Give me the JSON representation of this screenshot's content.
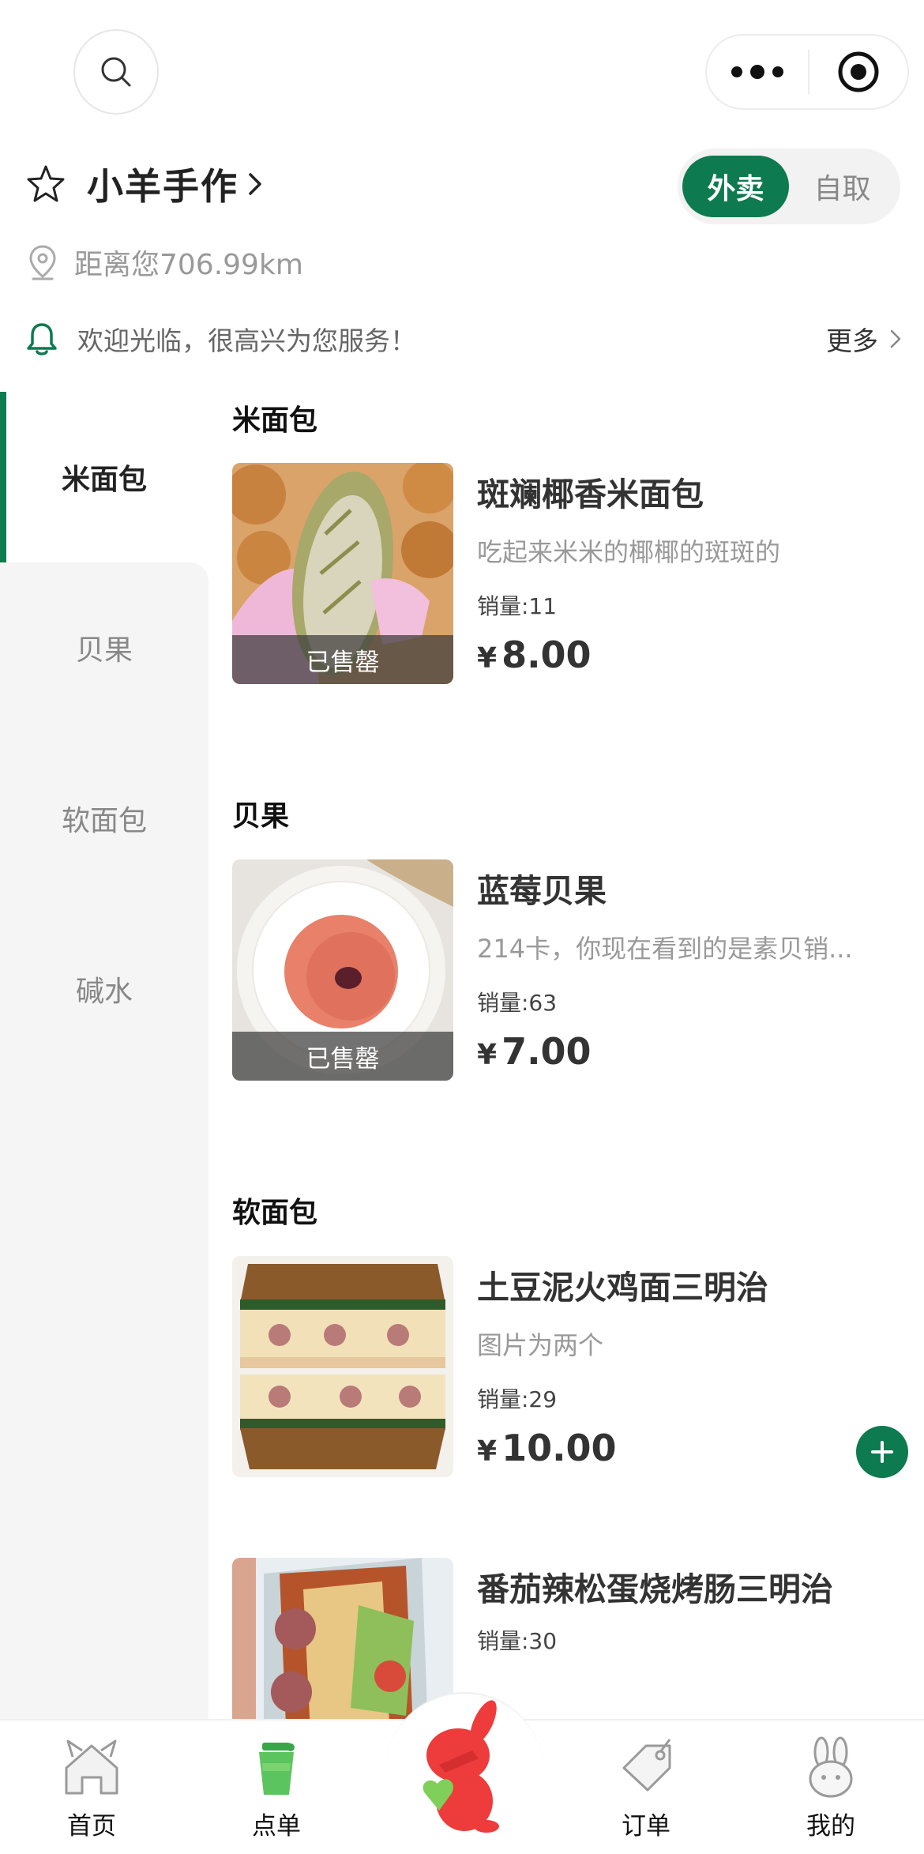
{
  "top": {
    "search_icon": "search-icon",
    "more_icon": "more-dots-icon",
    "target_icon": "target-icon"
  },
  "shop": {
    "name": "小羊手作",
    "distance": "距离您706.99km",
    "notice": "欢迎光临，很高兴为您服务！",
    "more_label": "更多",
    "delivery_label": "外卖",
    "pickup_label": "自取"
  },
  "sidebar": {
    "items": [
      {
        "label": "米面包",
        "active": true
      },
      {
        "label": "贝果",
        "active": false
      },
      {
        "label": "软面包",
        "active": false
      },
      {
        "label": "碱水",
        "active": false
      }
    ]
  },
  "sections": [
    {
      "title": "米面包",
      "products": [
        {
          "name": "斑斓椰香米面包",
          "desc": "吃起来米米的椰椰的斑斑的",
          "sales": "销量:11",
          "price": "8.00",
          "currency": "¥",
          "status": "已售罄"
        }
      ]
    },
    {
      "title": "贝果",
      "products": [
        {
          "name": "蓝莓贝果",
          "desc": "214卡，你现在看到的是素贝销...",
          "sales": "销量:63",
          "price": "7.00",
          "currency": "¥",
          "status": "已售罄"
        }
      ]
    },
    {
      "title": "软面包",
      "products": [
        {
          "name": "土豆泥火鸡面三明治",
          "desc": "图片为两个",
          "sales": "销量:29",
          "price": "10.00",
          "currency": "¥"
        },
        {
          "name": "番茄辣松蛋烧烤肠三明治",
          "sales": "销量:30"
        }
      ]
    }
  ],
  "tabbar": {
    "items": [
      {
        "label": "首页",
        "icon": "home-icon"
      },
      {
        "label": "点单",
        "icon": "order-cup-icon"
      },
      {
        "label": "订单",
        "icon": "orders-tag-icon"
      },
      {
        "label": "我的",
        "icon": "bunny-profile-icon"
      }
    ],
    "center_icon": "mascot-icon"
  },
  "colors": {
    "accent": "#0d7a4f",
    "sidebar_bg": "#f5f5f5"
  }
}
